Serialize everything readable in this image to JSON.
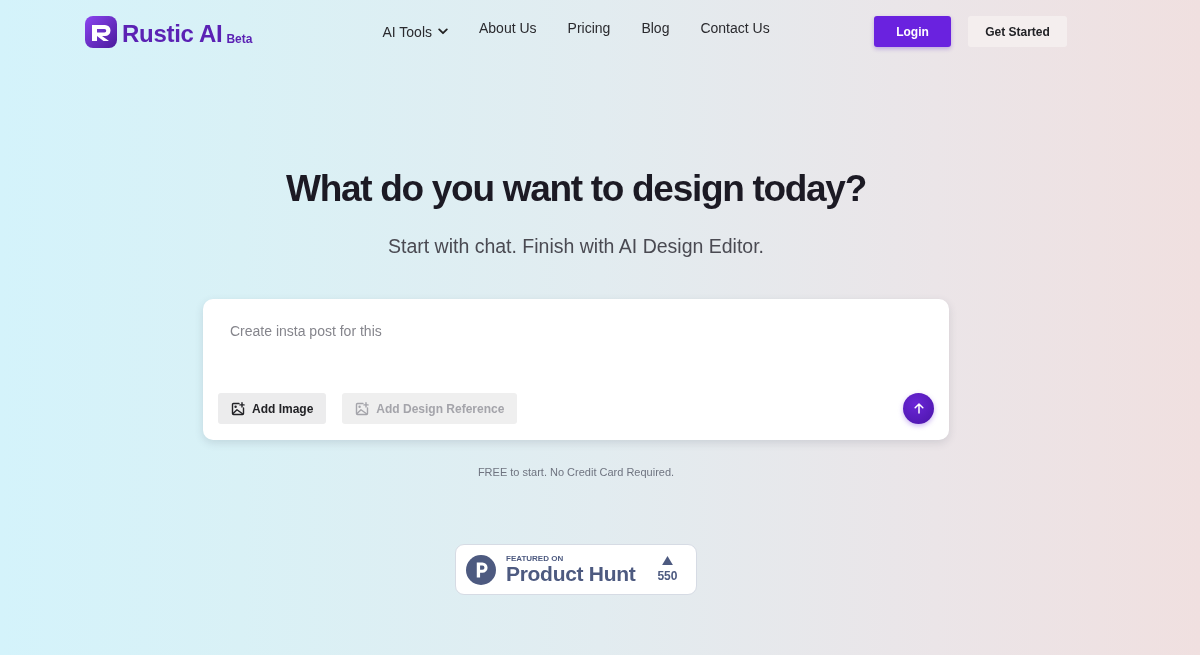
{
  "header": {
    "logo": {
      "name": "Rustic AI",
      "badge": "Beta"
    },
    "nav": [
      {
        "label": "AI Tools",
        "dropdown": true
      },
      {
        "label": "About Us",
        "dropdown": false
      },
      {
        "label": "Pricing",
        "dropdown": false
      },
      {
        "label": "Blog",
        "dropdown": false
      },
      {
        "label": "Contact Us",
        "dropdown": false
      }
    ],
    "buttons": [
      {
        "label": "Login",
        "kind": "primary"
      },
      {
        "label": "Get Started",
        "kind": "secondary"
      }
    ]
  },
  "hero": {
    "title": "What do you want to design today?",
    "subtitle": "Start with chat. Finish with AI Design Editor."
  },
  "prompt": {
    "placeholder": "Create insta post for this",
    "actions": [
      {
        "label": "Add Image",
        "disabled": false
      },
      {
        "label": "Add Design Reference",
        "disabled": true
      }
    ]
  },
  "note": "FREE to start. No Credit Card Required.",
  "featured_badge": {
    "eyebrow": "FEATURED ON",
    "title": "Product Hunt",
    "votes": "550"
  }
}
